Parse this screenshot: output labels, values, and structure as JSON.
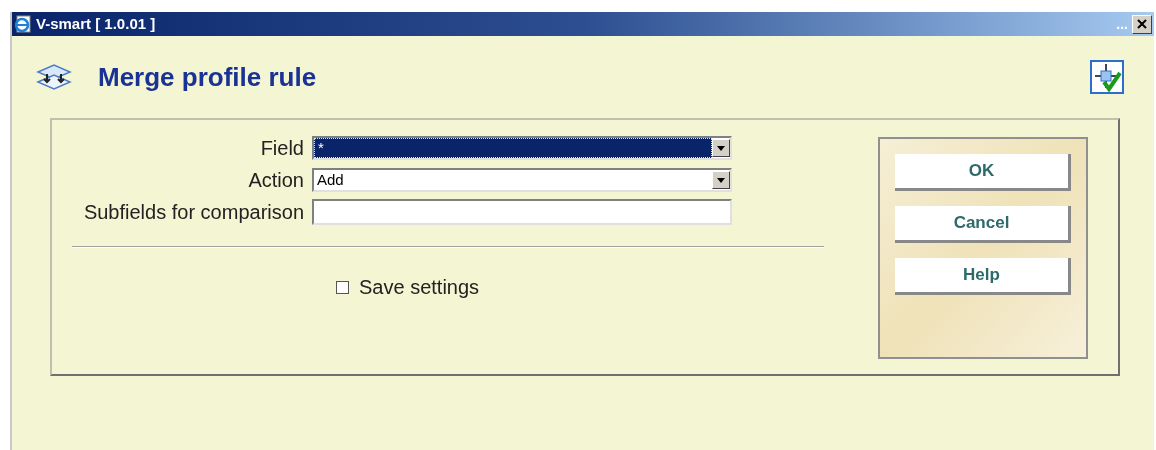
{
  "window": {
    "title": "V-smart [ 1.0.01 ]",
    "title_right": "..."
  },
  "heading": "Merge profile rule",
  "form": {
    "fields": [
      {
        "label": "Field",
        "kind": "select",
        "value": "*",
        "highlighted": true
      },
      {
        "label": "Action",
        "kind": "select",
        "value": "Add",
        "highlighted": false
      },
      {
        "label": "Subfields for comparison",
        "kind": "text",
        "highlighted": false
      }
    ],
    "save_settings": {
      "label": "Save settings",
      "checked": false
    }
  },
  "buttons": [
    "OK",
    "Cancel",
    "Help"
  ]
}
